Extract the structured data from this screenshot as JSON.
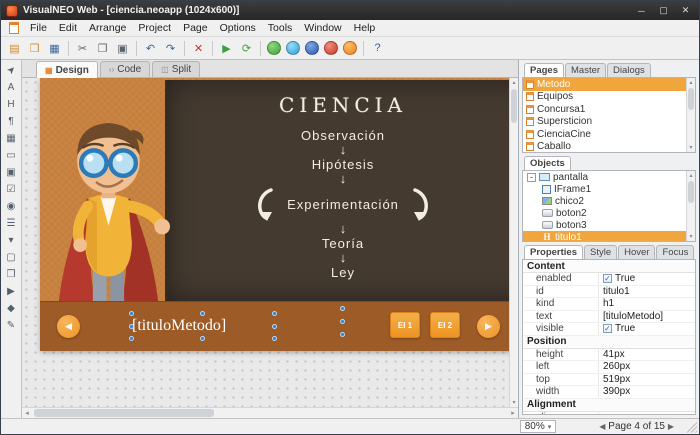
{
  "titlebar": {
    "title": "VisualNEO Web - [ciencia.neoapp (1024x600)]"
  },
  "menubar": {
    "items": [
      "File",
      "Edit",
      "Arrange",
      "Project",
      "Page",
      "Options",
      "Tools",
      "Window",
      "Help"
    ]
  },
  "doc_tabs": {
    "design": "Design",
    "code": "Code",
    "split": "Split"
  },
  "design": {
    "board": {
      "title": "CIENCIA",
      "step1": "Observación",
      "step2": "Hipótesis",
      "step3": "Experimentación",
      "step4": "Teoría",
      "step5": "Ley"
    },
    "nav": {
      "title_placeholder": "[tituloMetodo]",
      "button1": "El 1",
      "button2": "El 2"
    }
  },
  "pages_panel": {
    "tabs": [
      "Pages",
      "Master",
      "Dialogs"
    ],
    "items": [
      "Metodo",
      "Equipos",
      "Concursa1",
      "Supersticion",
      "CienciaCine",
      "Caballo"
    ]
  },
  "objects_panel": {
    "tab": "Objects",
    "root": "pantalla",
    "children": [
      "IFrame1",
      "chico2",
      "boton2",
      "boton3",
      "titulo1"
    ]
  },
  "properties_panel": {
    "tabs": [
      "Properties",
      "Style",
      "Hover",
      "Focus"
    ],
    "content_title": "Content",
    "rows_content": {
      "enabled_label": "enabled",
      "enabled_value": "True",
      "id_label": "id",
      "id_value": "titulo1",
      "kind_label": "kind",
      "kind_value": "h1",
      "text_label": "text",
      "text_value": "[tituloMetodo]",
      "visible_label": "visible",
      "visible_value": "True"
    },
    "position_title": "Position",
    "rows_position": {
      "height_label": "height",
      "height_value": "41px",
      "left_label": "left",
      "left_value": "260px",
      "top_label": "top",
      "top_value": "519px",
      "width_label": "width",
      "width_value": "390px"
    },
    "alignment_title": "Alignment",
    "rows_alignment": {
      "align_label": "align",
      "align_value": ""
    }
  },
  "statusbar": {
    "zoom": "80%",
    "page_info": "Page 4 of 15"
  },
  "icons": {
    "minimize": "─",
    "maximize": "▢",
    "close": "✕",
    "prev": "◀",
    "next": "▶",
    "up": "▴",
    "down": "▾",
    "left": "◂",
    "right": "▸",
    "down_arrow": "↓",
    "check": "✓",
    "expander": "-",
    "tab_design": "▦",
    "tab_code": "‹›",
    "tab_split": "◫",
    "toolbar": [
      "▤",
      "❒",
      "▦",
      "✂",
      "❐",
      "▣",
      "↶",
      "↷",
      "✕",
      "▶",
      "⟳",
      "?"
    ],
    "palette": [
      "➤",
      "A",
      "H",
      "¶",
      "▦",
      "▭",
      "▣",
      "☑",
      "◉",
      "☰",
      "▾",
      "▢",
      "❒",
      "▶",
      "◆",
      "✎"
    ]
  },
  "colors": {
    "accent_orange": "#f0a63c",
    "page_background": "#c8823f",
    "chalkboard": "#443a30"
  }
}
